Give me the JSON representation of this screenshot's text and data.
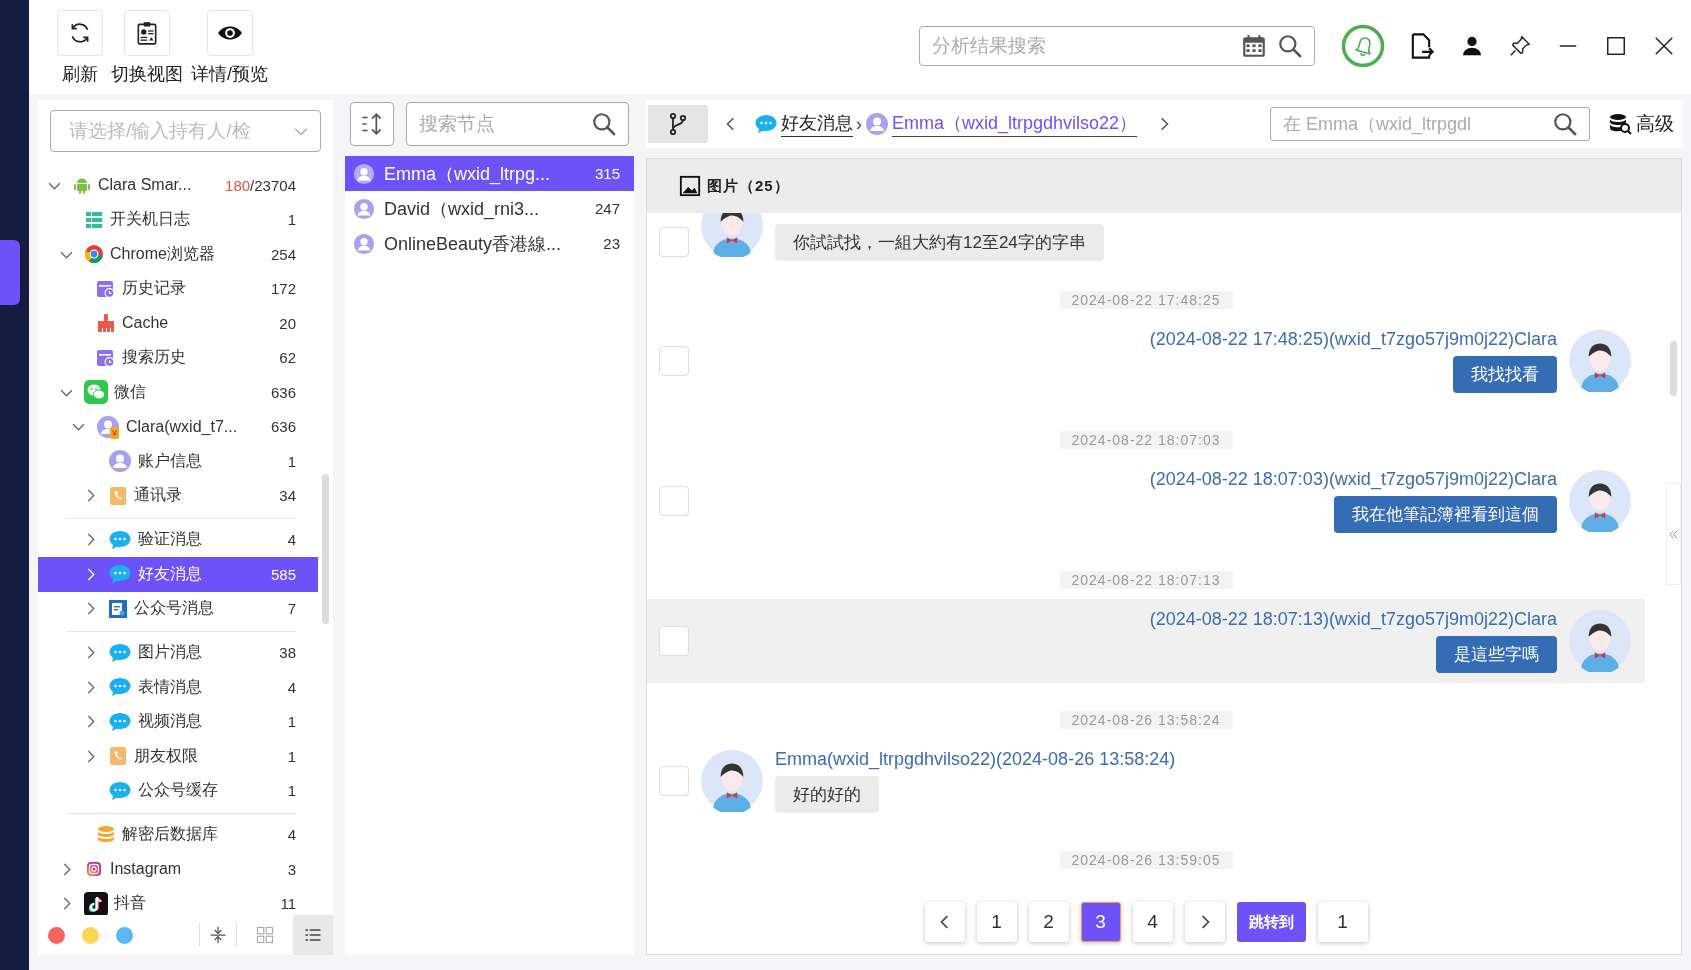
{
  "toolbar": {
    "buttons": [
      {
        "kind": "refresh",
        "label": "刷新"
      },
      {
        "kind": "clipboard",
        "label": "切换视图"
      },
      {
        "kind": "eye",
        "label": "详情/预览"
      }
    ]
  },
  "top_search": {
    "placeholder": "分析结果搜索"
  },
  "owner_select": {
    "placeholder": "请选择/输入持有人/检"
  },
  "tree": [
    {
      "kind": "android",
      "label": "Clara Smar...",
      "flagged": "180",
      "count": "/23704",
      "expanded": true,
      "selected": false,
      "children": [
        {
          "kind": "list",
          "label": "开关机日志",
          "count": "1",
          "selected": false
        },
        {
          "kind": "chrome",
          "label": "Chrome浏览器",
          "count": "254",
          "expanded": true,
          "selected": false,
          "children": [
            {
              "kind": "history",
              "label": "历史记录",
              "count": "172",
              "selected": false
            },
            {
              "kind": "broom",
              "label": "Cache",
              "count": "20",
              "selected": false
            },
            {
              "kind": "history",
              "label": "搜索历史",
              "count": "62",
              "selected": false
            }
          ]
        },
        {
          "kind": "wechat",
          "label": "微信",
          "count": "636",
          "expanded": true,
          "selected": false,
          "children": [
            {
              "kind": "user",
              "badge": "¥",
              "label": "Clara(wxid_t7...",
              "count": "636",
              "expanded": true,
              "selected": false,
              "divider_above": false,
              "children": [
                {
                  "kind": "user",
                  "label": "账户信息",
                  "count": "1",
                  "selected": false,
                  "divider_above": false
                },
                {
                  "kind": "contacts",
                  "label": "通讯录",
                  "count": "34",
                  "expanded": false,
                  "selected": false,
                  "divider_above": false
                },
                {
                  "kind": "bubble",
                  "label": "验证消息",
                  "count": "4",
                  "expanded": false,
                  "selected": false,
                  "divider_above": true
                },
                {
                  "kind": "bubble",
                  "label": "好友消息",
                  "count": "585",
                  "expanded": false,
                  "selected": true,
                  "divider_above": false
                },
                {
                  "kind": "article",
                  "label": "公众号消息",
                  "count": "7",
                  "expanded": false,
                  "selected": false,
                  "divider_above": false
                },
                {
                  "kind": "bubble",
                  "label": "图片消息",
                  "count": "38",
                  "expanded": false,
                  "selected": false,
                  "divider_above": true
                },
                {
                  "kind": "bubble",
                  "label": "表情消息",
                  "count": "4",
                  "expanded": false,
                  "selected": false,
                  "divider_above": false
                },
                {
                  "kind": "bubble",
                  "label": "视频消息",
                  "count": "1",
                  "expanded": false,
                  "selected": false,
                  "divider_above": false
                },
                {
                  "kind": "contacts",
                  "label": "朋友权限",
                  "count": "1",
                  "expanded": false,
                  "selected": false,
                  "divider_above": false
                },
                {
                  "kind": "bubble",
                  "label": "公众号缓存",
                  "count": "1",
                  "selected": false,
                  "divider_above": false
                }
              ]
            },
            {
              "kind": "database",
              "label": "解密后数据库",
              "count": "4",
              "selected": false,
              "divider_above": true
            }
          ]
        },
        {
          "kind": "instagram",
          "label": "Instagram",
          "count": "3",
          "expanded": false,
          "selected": false
        },
        {
          "kind": "tiktok",
          "label": "抖音",
          "count": "11",
          "expanded": false,
          "selected": false
        }
      ]
    }
  ],
  "legend_dots": [
    {
      "color": "#f2665e"
    },
    {
      "color": "#fcd752"
    },
    {
      "color": "#5ab8f5"
    }
  ],
  "view_modes": [
    {
      "kind": "grid",
      "selected": false
    },
    {
      "kind": "list",
      "selected": true
    }
  ],
  "node_search": {
    "placeholder": "搜索节点"
  },
  "contacts": [
    {
      "name": "Emma（wxid_ltrpg...",
      "count": "315",
      "selected": true
    },
    {
      "name": "David（wxid_rni3...",
      "count": "247",
      "selected": false
    },
    {
      "name": "OnlineBeauty香港線...",
      "count": "23",
      "selected": false
    }
  ],
  "breadcrumb": [
    {
      "kind": "bubble",
      "label": "好友消息"
    },
    {
      "kind": "user",
      "separator": "›",
      "label": "Emma（wxid_ltrpgdhvilso22）"
    }
  ],
  "chat_search": {
    "placeholder": "在 Emma（wxid_ltrpgdl"
  },
  "advanced_button": "高级",
  "tabs": [
    {
      "label": "图片（25）"
    }
  ],
  "messages": [
    {
      "kind": "received",
      "text": "你試試找，一組大約有12至24字的字串",
      "checked": false,
      "highlighted": false
    },
    {
      "kind": "time",
      "text": "2024-08-22 17:48:25"
    },
    {
      "kind": "sent",
      "sender": "(2024-08-22 17:48:25)(wxid_t7zgo57j9m0j22)Clara",
      "text": "我找找看",
      "checked": false,
      "highlighted": false
    },
    {
      "kind": "time",
      "text": "2024-08-22 18:07:03"
    },
    {
      "kind": "sent",
      "sender": "(2024-08-22 18:07:03)(wxid_t7zgo57j9m0j22)Clara",
      "text": "我在他筆記簿裡看到這個",
      "checked": false,
      "highlighted": false
    },
    {
      "kind": "time",
      "text": "2024-08-22 18:07:13"
    },
    {
      "kind": "sent",
      "sender": "(2024-08-22 18:07:13)(wxid_t7zgo57j9m0j22)Clara",
      "text": "是這些字嗎",
      "checked": false,
      "highlighted": true
    },
    {
      "kind": "time",
      "text": "2024-08-26 13:58:24"
    },
    {
      "kind": "received",
      "sender": "Emma(wxid_ltrpgdhvilso22)(2024-08-26 13:58:24)",
      "text": "好的好的",
      "checked": false,
      "highlighted": false
    },
    {
      "kind": "time",
      "text": "2024-08-26 13:59:05"
    }
  ],
  "pagination": {
    "pages": [
      {
        "label": "1",
        "selected": false
      },
      {
        "label": "2",
        "selected": false
      },
      {
        "label": "3",
        "selected": true
      },
      {
        "label": "4",
        "selected": false
      }
    ],
    "jump_label": "跳转到",
    "jump_value": "1"
  }
}
